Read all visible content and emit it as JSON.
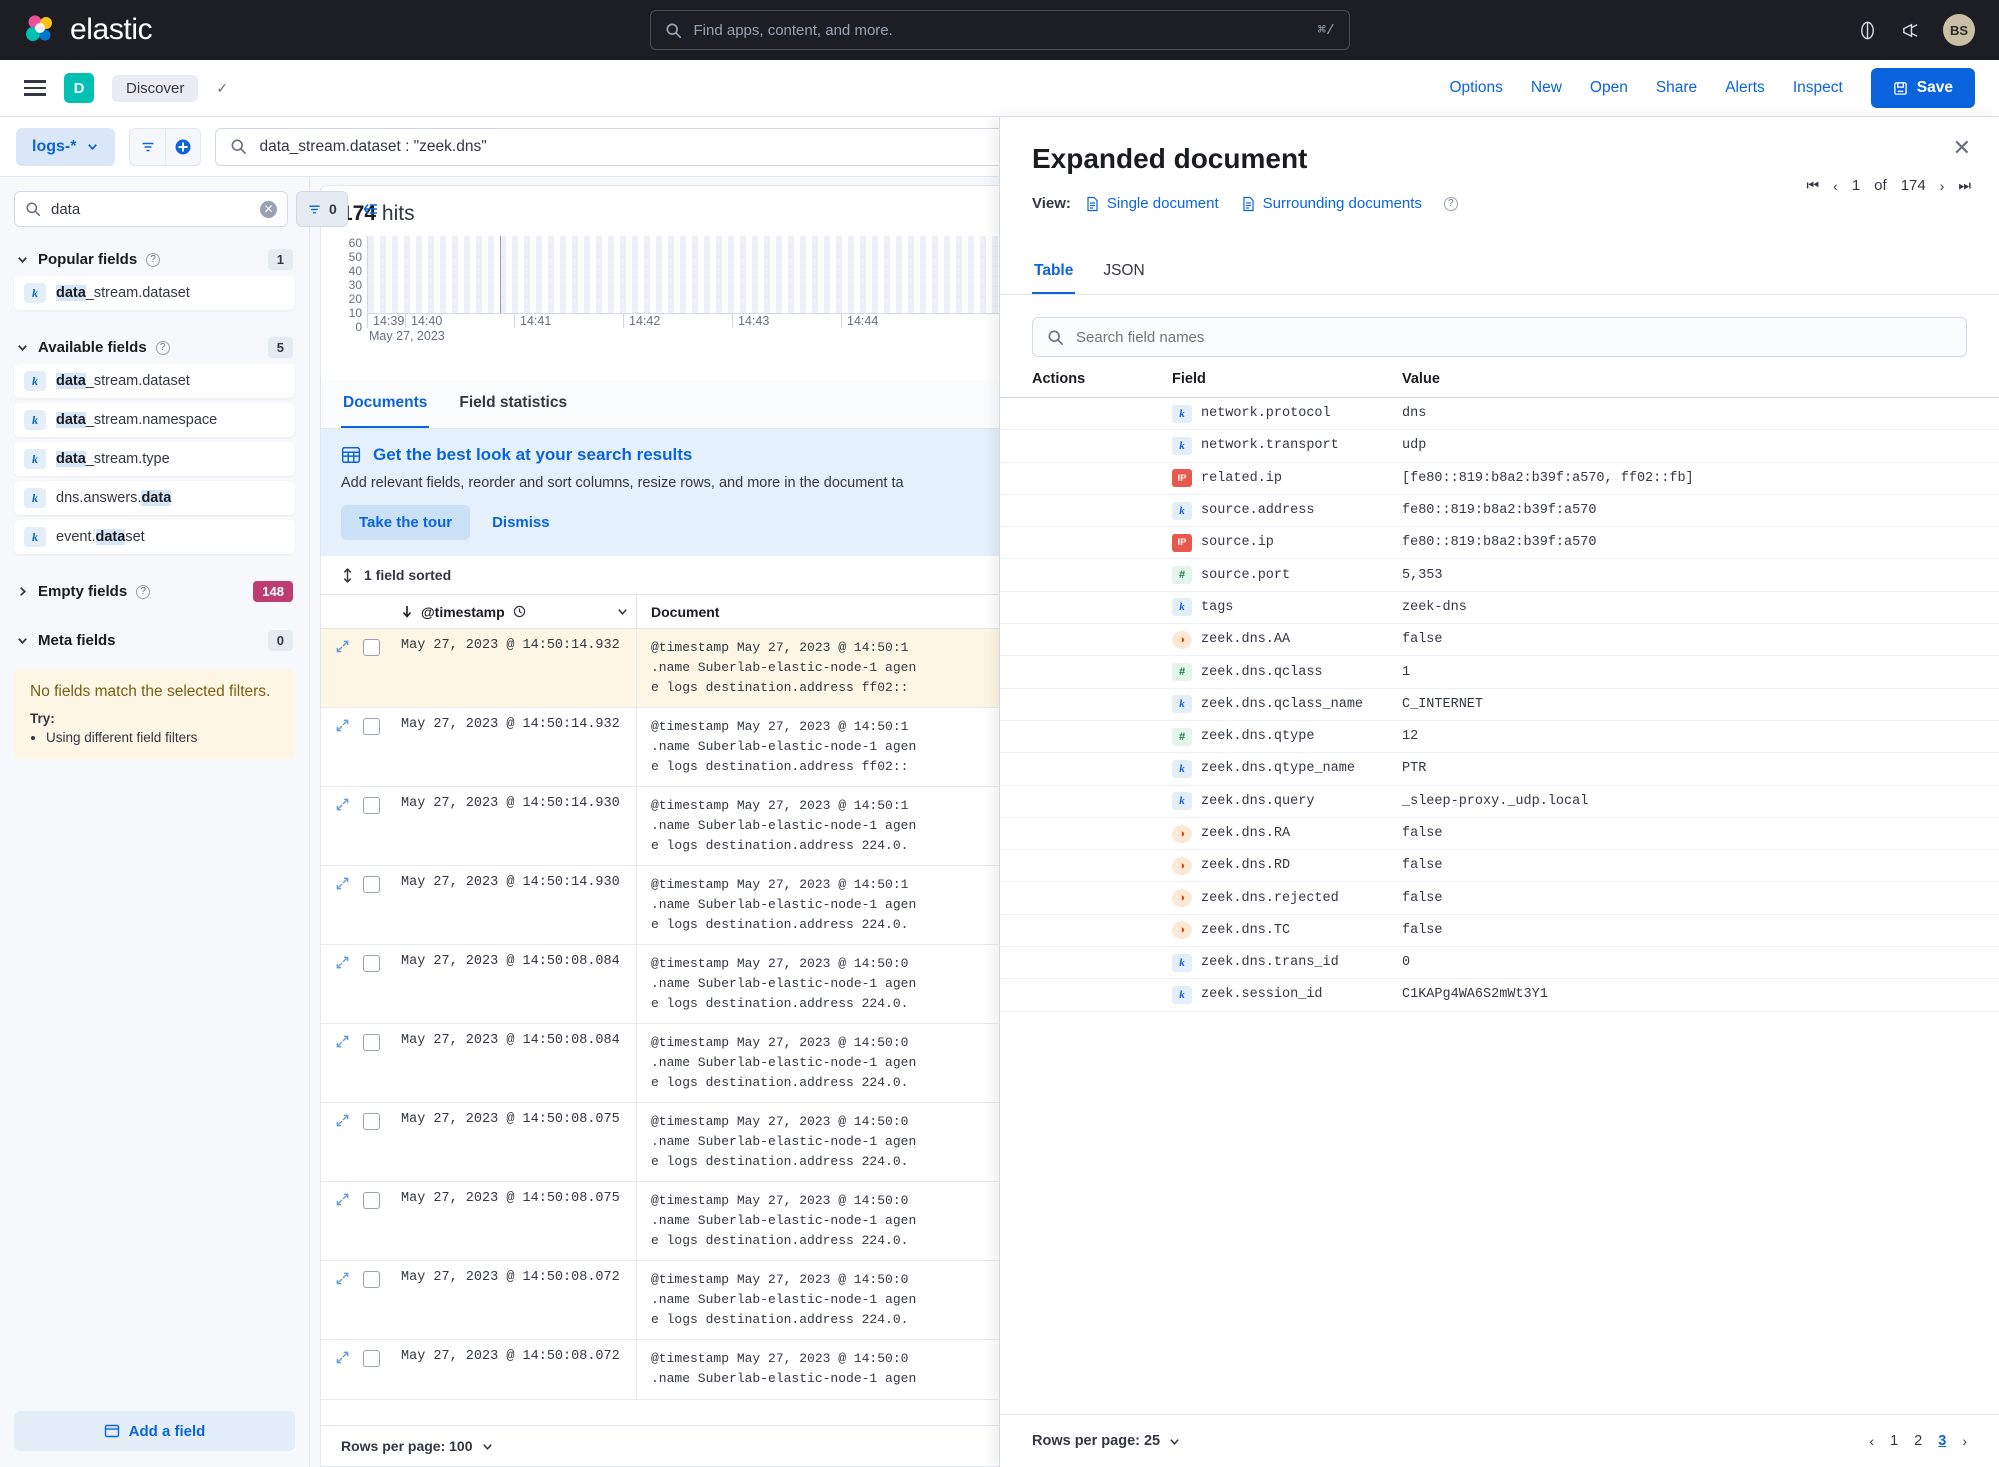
{
  "topnav": {
    "brand": "elastic",
    "search_placeholder": "Find apps, content, and more.",
    "search_shortcut": "⌘/",
    "avatar_initials": "BS",
    "icons": [
      "help-circle-icon",
      "announcement-icon"
    ]
  },
  "subheader": {
    "app_initial": "D",
    "breadcrumb": "Discover",
    "links": [
      "Options",
      "New",
      "Open",
      "Share",
      "Alerts",
      "Inspect"
    ],
    "save_label": "Save"
  },
  "querybar": {
    "dataview": "logs-*",
    "query": "data_stream.dataset : \"zeek.dns\""
  },
  "sidebar": {
    "field_search_value": "data",
    "field_search_placeholder": "Search field names",
    "filter_count": "0",
    "groups": [
      {
        "title": "Popular fields",
        "badge": "1",
        "badge_style": "grey",
        "expanded": true,
        "fields": [
          {
            "type": "k",
            "pre": "",
            "match": "data",
            "post": "_stream.dataset"
          }
        ]
      },
      {
        "title": "Available fields",
        "badge": "5",
        "badge_style": "grey",
        "expanded": true,
        "fields": [
          {
            "type": "k",
            "pre": "",
            "match": "data",
            "post": "_stream.dataset"
          },
          {
            "type": "k",
            "pre": "",
            "match": "data",
            "post": "_stream.namespace"
          },
          {
            "type": "k",
            "pre": "",
            "match": "data",
            "post": "_stream.type"
          },
          {
            "type": "k",
            "pre": "dns.answers.",
            "match": "data",
            "post": ""
          },
          {
            "type": "k",
            "pre": "event.",
            "match": "data",
            "post": "set"
          }
        ]
      },
      {
        "title": "Empty fields",
        "badge": "148",
        "badge_style": "pink",
        "expanded": false,
        "fields": []
      },
      {
        "title": "Meta fields",
        "badge": "0",
        "badge_style": "grey",
        "expanded": true,
        "fields": []
      }
    ],
    "callout": {
      "title": "No fields match the selected filters.",
      "try_label": "Try:",
      "items": [
        "Using different field filters"
      ]
    },
    "add_field_label": "Add a field"
  },
  "chart_data": {
    "type": "bar",
    "title": "174 hits",
    "hits_count": "174",
    "hits_suffix": "hits",
    "xlabel": "",
    "ylabel": "",
    "ylim": [
      0,
      60
    ],
    "yticks": [
      "60",
      "50",
      "40",
      "30",
      "20",
      "10",
      "0"
    ],
    "xticks": [
      "14:39",
      "14:40",
      "14:41",
      "14:42",
      "14:43",
      "14:44"
    ],
    "x_date_label": "May 27, 2023",
    "grid": true,
    "categories": [
      "14:39",
      "14:40",
      "14:41",
      "14:42",
      "14:43",
      "14:44"
    ],
    "values": [
      0,
      0,
      0,
      0,
      0,
      0
    ],
    "timestamp_label": "May 27, 2023 @"
  },
  "center": {
    "tabs": [
      {
        "label": "Documents",
        "active": true
      },
      {
        "label": "Field statistics",
        "active": false
      }
    ],
    "tour": {
      "title": "Get the best look at your search results",
      "body": "Add relevant fields, reorder and sort columns, resize rows, and more in the document ta",
      "primary": "Take the tour",
      "secondary": "Dismiss"
    },
    "sorted_label": "1 field sorted",
    "columns": [
      "@timestamp",
      "Document"
    ],
    "rows": [
      {
        "ts": "May 27, 2023 @ 14:50:14.932",
        "l1": "@timestamp May 27, 2023 @ 14:50:1",
        "l2": ".name Suberlab-elastic-node-1 agen",
        "l3": "e logs destination.address ff02::",
        "highlight": true
      },
      {
        "ts": "May 27, 2023 @ 14:50:14.932",
        "l1": "@timestamp May 27, 2023 @ 14:50:1",
        "l2": ".name Suberlab-elastic-node-1 agen",
        "l3": "e logs destination.address ff02::",
        "highlight": false
      },
      {
        "ts": "May 27, 2023 @ 14:50:14.930",
        "l1": "@timestamp May 27, 2023 @ 14:50:1",
        "l2": ".name Suberlab-elastic-node-1 agen",
        "l3": "e logs destination.address 224.0.",
        "highlight": false
      },
      {
        "ts": "May 27, 2023 @ 14:50:14.930",
        "l1": "@timestamp May 27, 2023 @ 14:50:1",
        "l2": ".name Suberlab-elastic-node-1 agen",
        "l3": "e logs destination.address 224.0.",
        "highlight": false
      },
      {
        "ts": "May 27, 2023 @ 14:50:08.084",
        "l1": "@timestamp May 27, 2023 @ 14:50:0",
        "l2": ".name Suberlab-elastic-node-1 agen",
        "l3": "e logs destination.address 224.0.",
        "highlight": false
      },
      {
        "ts": "May 27, 2023 @ 14:50:08.084",
        "l1": "@timestamp May 27, 2023 @ 14:50:0",
        "l2": ".name Suberlab-elastic-node-1 agen",
        "l3": "e logs destination.address 224.0.",
        "highlight": false
      },
      {
        "ts": "May 27, 2023 @ 14:50:08.075",
        "l1": "@timestamp May 27, 2023 @ 14:50:0",
        "l2": ".name Suberlab-elastic-node-1 agen",
        "l3": "e logs destination.address 224.0.",
        "highlight": false
      },
      {
        "ts": "May 27, 2023 @ 14:50:08.075",
        "l1": "@timestamp May 27, 2023 @ 14:50:0",
        "l2": ".name Suberlab-elastic-node-1 agen",
        "l3": "e logs destination.address 224.0.",
        "highlight": false
      },
      {
        "ts": "May 27, 2023 @ 14:50:08.072",
        "l1": "@timestamp May 27, 2023 @ 14:50:0",
        "l2": ".name Suberlab-elastic-node-1 agen",
        "l3": "e logs destination.address 224.0.",
        "highlight": false
      },
      {
        "ts": "May 27, 2023 @ 14:50:08.072",
        "l1": "@timestamp May 27, 2023 @ 14:50:0",
        "l2": ".name Suberlab-elastic-node-1 agen",
        "l3": "",
        "highlight": false
      }
    ],
    "rows_per_page_label": "Rows per page: 100"
  },
  "flyout": {
    "title": "Expanded document",
    "view_label": "View:",
    "view_single": "Single document",
    "view_surrounding": "Surrounding documents",
    "pager_current": "1",
    "pager_of": "of",
    "pager_total": "174",
    "tabs": [
      {
        "label": "Table",
        "active": true
      },
      {
        "label": "JSON",
        "active": false
      }
    ],
    "search_placeholder": "Search field names",
    "columns": {
      "actions": "Actions",
      "field": "Field",
      "value": "Value"
    },
    "rows": [
      {
        "type": "k",
        "field": "network.protocol",
        "value": "dns"
      },
      {
        "type": "k",
        "field": "network.transport",
        "value": "udp"
      },
      {
        "type": "ip",
        "field": "related.ip",
        "value": "[fe80::819:b8a2:b39f:a570, ff02::fb]"
      },
      {
        "type": "k",
        "field": "source.address",
        "value": "fe80::819:b8a2:b39f:a570"
      },
      {
        "type": "ip",
        "field": "source.ip",
        "value": "fe80::819:b8a2:b39f:a570"
      },
      {
        "type": "num",
        "field": "source.port",
        "value": "5,353"
      },
      {
        "type": "k",
        "field": "tags",
        "value": "zeek-dns"
      },
      {
        "type": "bool",
        "field": "zeek.dns.AA",
        "value": "false"
      },
      {
        "type": "num",
        "field": "zeek.dns.qclass",
        "value": "1"
      },
      {
        "type": "k",
        "field": "zeek.dns.qclass_name",
        "value": "C_INTERNET"
      },
      {
        "type": "num",
        "field": "zeek.dns.qtype",
        "value": "12"
      },
      {
        "type": "k",
        "field": "zeek.dns.qtype_name",
        "value": "PTR"
      },
      {
        "type": "k",
        "field": "zeek.dns.query",
        "value": "_sleep-proxy._udp.local"
      },
      {
        "type": "bool",
        "field": "zeek.dns.RA",
        "value": "false"
      },
      {
        "type": "bool",
        "field": "zeek.dns.RD",
        "value": "false"
      },
      {
        "type": "bool",
        "field": "zeek.dns.rejected",
        "value": "false"
      },
      {
        "type": "bool",
        "field": "zeek.dns.TC",
        "value": "false"
      },
      {
        "type": "k",
        "field": "zeek.dns.trans_id",
        "value": "0"
      },
      {
        "type": "k",
        "field": "zeek.session_id",
        "value": "C1KAPg4WA6S2mWt3Y1"
      }
    ],
    "rows_per_page_label": "Rows per page: 25",
    "pages": [
      "1",
      "2",
      "3"
    ],
    "active_page": "3"
  },
  "colors": {
    "accent": "#0B64DD",
    "brand_dark": "#1D1E24",
    "teal": "#00BFB3",
    "pink": "#BD3D70",
    "warn_bg": "#FDF6E4"
  }
}
